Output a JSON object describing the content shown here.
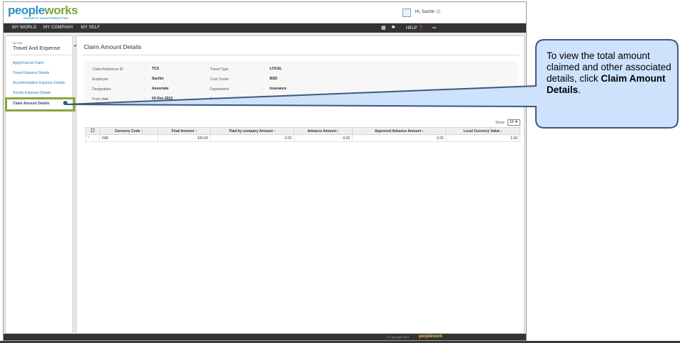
{
  "header": {
    "logo_a": "pe",
    "logo_b": "ople",
    "logo_c": "works",
    "tagline": "GROWTH UNINTERRUPTED",
    "greeting": "Hi, Sachin"
  },
  "nav": {
    "items": [
      "MY WORLD",
      "MY COMPANY",
      "MY SELF"
    ],
    "help": "HELP"
  },
  "sidebar": {
    "breadcrumb": "My Self",
    "title": "Travel And Expense",
    "links": [
      "Apply/Cancel Claim",
      "Travel Expense Details",
      "Accommodation Expense Details",
      "Sundry Expense Details",
      "Claim Amount Details"
    ]
  },
  "page": {
    "title": "Claim Amount Details",
    "fields": [
      {
        "label": "Claim Reference ID",
        "value": "TCS"
      },
      {
        "label": "Travel Type",
        "value": "LOCAL"
      },
      {
        "label": "Employee",
        "value": "Sachin"
      },
      {
        "label": "Cost Center",
        "value": "BSD"
      },
      {
        "label": "Designation",
        "value": "Associate"
      },
      {
        "label": "Department",
        "value": "Insurance"
      },
      {
        "label": "From date",
        "value": "02-Dec-2013"
      },
      {
        "label": "To date",
        "value": "05-Dec-2013"
      }
    ],
    "colon": ":",
    "show_label": "Show",
    "show_value": "10"
  },
  "table": {
    "headers": [
      "Currency Code",
      "Final Amount",
      "Paid by company Amount",
      "Advance Amount",
      "Approved Advance Amount",
      "Local Currency Value"
    ],
    "sort_glyph": "↕",
    "rows": [
      [
        "INR",
        "100.00",
        "0.00",
        "0.00",
        "0.00",
        "1.00"
      ]
    ]
  },
  "footer": {
    "copyright": "© Copyright 2013",
    "logo": "peoplework"
  },
  "callout": {
    "text_plain": "To view the total amount claimed and other associated details, click ",
    "text_bold": "Claim Amount Details",
    "text_end": "."
  },
  "colors": {
    "brand_blue": "#2a8fc7",
    "brand_green": "#7aa636",
    "highlight": "#8aa43a",
    "callout_fill": "#cfe2fb",
    "callout_border": "#3a5b7e",
    "navbar": "#333333"
  }
}
